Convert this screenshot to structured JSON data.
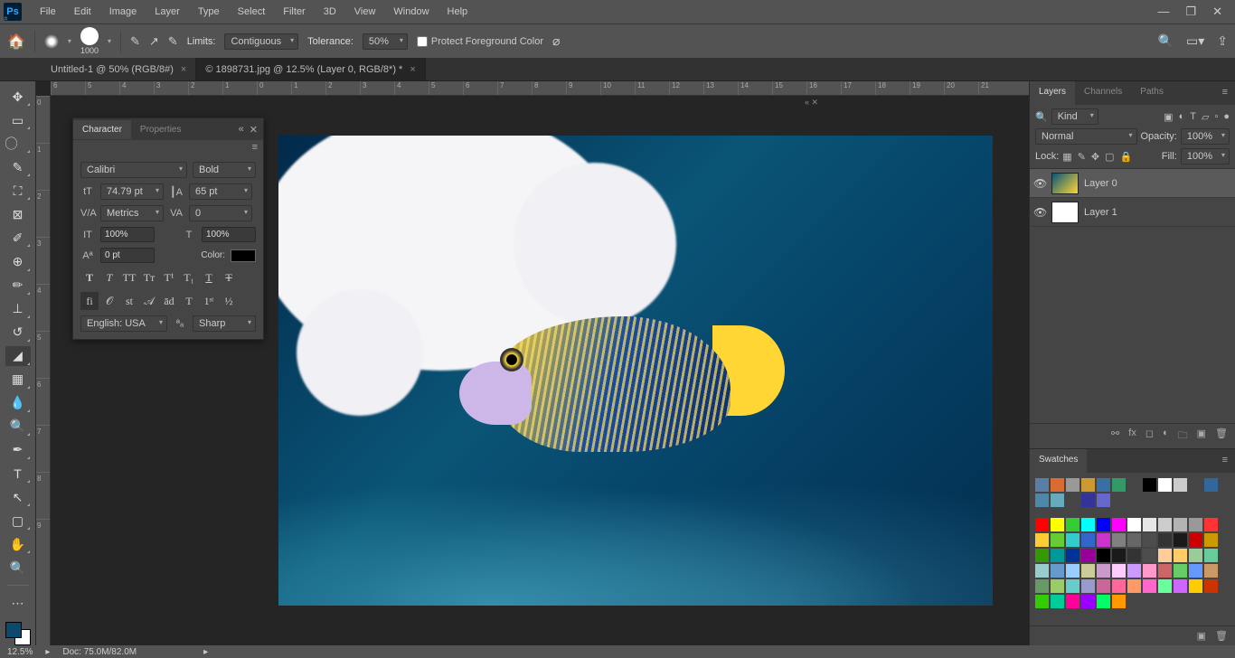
{
  "menu": {
    "items": [
      "File",
      "Edit",
      "Image",
      "Layer",
      "Type",
      "Select",
      "Filter",
      "3D",
      "View",
      "Window",
      "Help"
    ]
  },
  "optionbar": {
    "brush_size": "1000",
    "limits_label": "Limits:",
    "limits_value": "Contiguous",
    "tolerance_label": "Tolerance:",
    "tolerance_value": "50%",
    "protect_fg": "Protect Foreground Color"
  },
  "tabs": [
    {
      "label": "Untitled-1 @ 50% (RGB/8#)",
      "active": false
    },
    {
      "label": "© 1898731.jpg @ 12.5% (Layer 0, RGB/8*) *",
      "active": true
    }
  ],
  "ruler_h": [
    "6",
    "5",
    "4",
    "3",
    "2",
    "1",
    "0",
    "1",
    "2",
    "3",
    "4",
    "5",
    "6",
    "7",
    "8",
    "9",
    "10",
    "11",
    "12",
    "13",
    "14",
    "15",
    "16",
    "17",
    "18",
    "19",
    "20",
    "21"
  ],
  "ruler_v": [
    "0",
    "1",
    "2",
    "3",
    "4",
    "5",
    "6",
    "7",
    "8",
    "9"
  ],
  "character": {
    "tab1": "Character",
    "tab2": "Properties",
    "font": "Calibri",
    "weight": "Bold",
    "size": "74.79 pt",
    "leading": "65 pt",
    "kerning": "Metrics",
    "tracking": "0",
    "hscale": "100%",
    "vscale": "100%",
    "baseline": "0 pt",
    "color_label": "Color:",
    "language": "English: USA",
    "aa": "Sharp"
  },
  "layers": {
    "tab1": "Layers",
    "tab2": "Channels",
    "tab3": "Paths",
    "kind": "Kind",
    "blend": "Normal",
    "opacity_label": "Opacity:",
    "opacity": "100%",
    "lock_label": "Lock:",
    "fill_label": "Fill:",
    "fill": "100%",
    "items": [
      {
        "name": "Layer 0",
        "selected": true,
        "thumb": "fish"
      },
      {
        "name": "Layer 1",
        "selected": false,
        "thumb": "white"
      }
    ]
  },
  "swatches": {
    "title": "Swatches",
    "row1": [
      "#5a7fa6",
      "#d96b33",
      "#999999",
      "#cc9933",
      "#3a6fa6",
      "#339966",
      "",
      "#000000",
      "#ffffff",
      "#cccccc",
      "",
      "#336699",
      "#4d88aa",
      "#66aabb",
      "",
      "#333399",
      "#6666cc"
    ],
    "colors": [
      "#ff0000",
      "#ffff00",
      "#33cc33",
      "#00ffff",
      "#0000ff",
      "#ff00ff",
      "#ffffff",
      "#e6e6e6",
      "#cccccc",
      "#b3b3b3",
      "#999999",
      "#ff3333",
      "#ffcc33",
      "#66cc33",
      "#33cccc",
      "#3366cc",
      "#cc33cc",
      "#808080",
      "#666666",
      "#4d4d4d",
      "#333333",
      "#1a1a1a",
      "#cc0000",
      "#cc9900",
      "#339900",
      "#009999",
      "#003399",
      "#990099",
      "#000000",
      "#1a1a1a",
      "#333333",
      "#4d4d4d",
      "#ffcc99",
      "#ffcc66",
      "#99cc99",
      "#66cc99",
      "#99cccc",
      "#6699cc",
      "#99ccff",
      "#cccc99",
      "#cc99cc",
      "#ffccff",
      "#cc99ff",
      "#ff99cc",
      "#cc6666",
      "#66cc66",
      "#6699ff",
      "#cc9966",
      "#669966",
      "#99cc66",
      "#66cccc",
      "#9999cc",
      "#cc6699",
      "#ff6699",
      "#ff9966",
      "#ff66cc",
      "#66ff99",
      "#cc66ff",
      "#ffcc00",
      "#cc3300",
      "#33cc00",
      "#00cc99",
      "#ff0099",
      "#9900ff",
      "#00ff66",
      "#ff9900"
    ]
  },
  "status": {
    "zoom": "12.5%",
    "doc": "Doc: 75.0M/82.0M"
  }
}
